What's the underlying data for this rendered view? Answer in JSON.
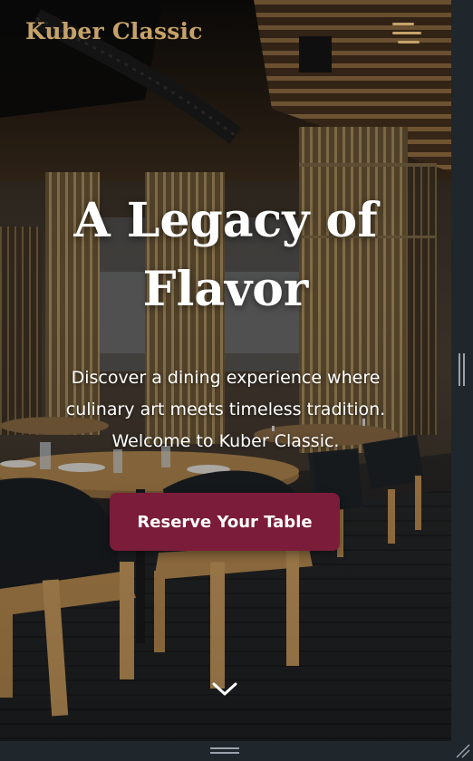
{
  "header": {
    "brand": "Kuber Classic",
    "menu_icon": "hamburger-menu-icon"
  },
  "hero": {
    "title_line1": "A Legacy of",
    "title_line2": "Flavor",
    "subtitle_line1": "Discover a dining experience where",
    "subtitle_line2": "culinary art meets timeless tradition.",
    "subtitle_line3": "Welcome to Kuber Classic.",
    "cta_label": "Reserve Your Table",
    "scroll_icon": "chevron-down-icon"
  },
  "colors": {
    "brand_gold": "#c6a269",
    "cta_burgundy": "#7b1c3a",
    "text_white": "#ffffff"
  }
}
